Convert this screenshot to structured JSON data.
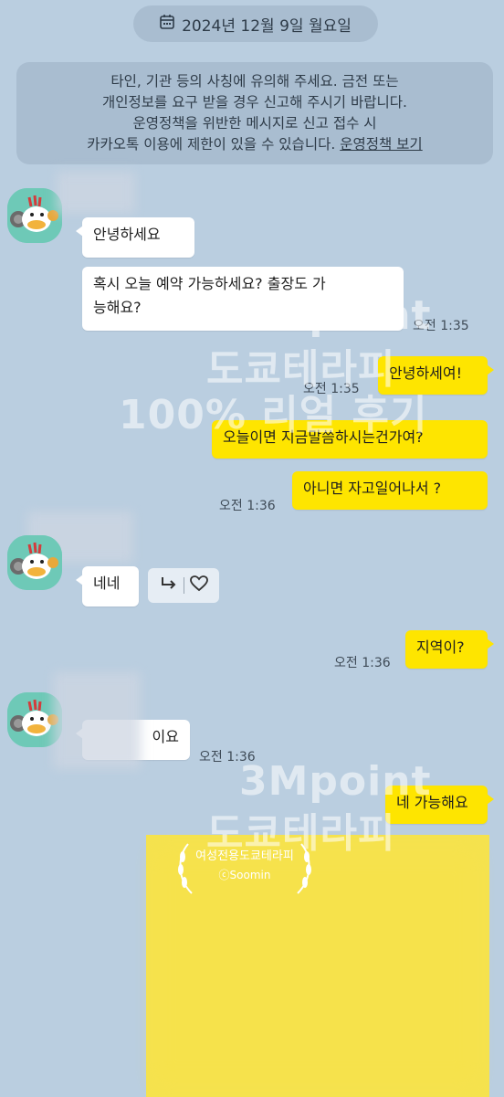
{
  "date_divider": {
    "label": "2024년 12월 9일 월요일",
    "icon": "calendar-icon"
  },
  "notice": {
    "line1": "타인, 기관 등의 사칭에 유의해 주세요. 금전 또는",
    "line2": "개인정보를 요구 받을 경우 신고해 주시기 바랍니다.",
    "line3": "운영정책을 위반한 메시지로 신고 접수 시",
    "line4": "카카오톡 이용에 제한이 있을 수 있습니다.",
    "link": "운영정책 보기"
  },
  "messages": [
    {
      "text": "안녕하세요"
    },
    {
      "text_line1": "혹시 오늘 예약 가능하세요? 출장도 가",
      "text_line2": "능해요?",
      "time": "오전 1:35"
    },
    {
      "text": "안녕하세여!",
      "time": "오전 1:35"
    },
    {
      "text": "오늘이면 지금말씀하시는건가여?"
    },
    {
      "text": "아니면 자고일어나서 ?",
      "time": "오전 1:36"
    },
    {
      "text": "네네"
    },
    {
      "text": "지역이?",
      "time": "오전 1:36"
    },
    {
      "text": "이요",
      "time": "오전 1:36"
    },
    {
      "text": "네 가능해요"
    }
  ],
  "reaction": {
    "reply_icon": "reply-arrow-icon",
    "like_icon": "heart-outline-icon"
  },
  "watermark": {
    "line1": "3Mpoint",
    "line2": "도쿄테라피",
    "line3": "100% 리얼 후기",
    "line1b": "3Mpoint",
    "line2b": "도쿄테라피"
  },
  "badge": {
    "title": "여성전용도쿄테라피",
    "credit": "ⓒSoomin"
  },
  "colors": {
    "background": "#bacee0",
    "my_bubble": "#fee500",
    "their_bubble": "#ffffff"
  }
}
